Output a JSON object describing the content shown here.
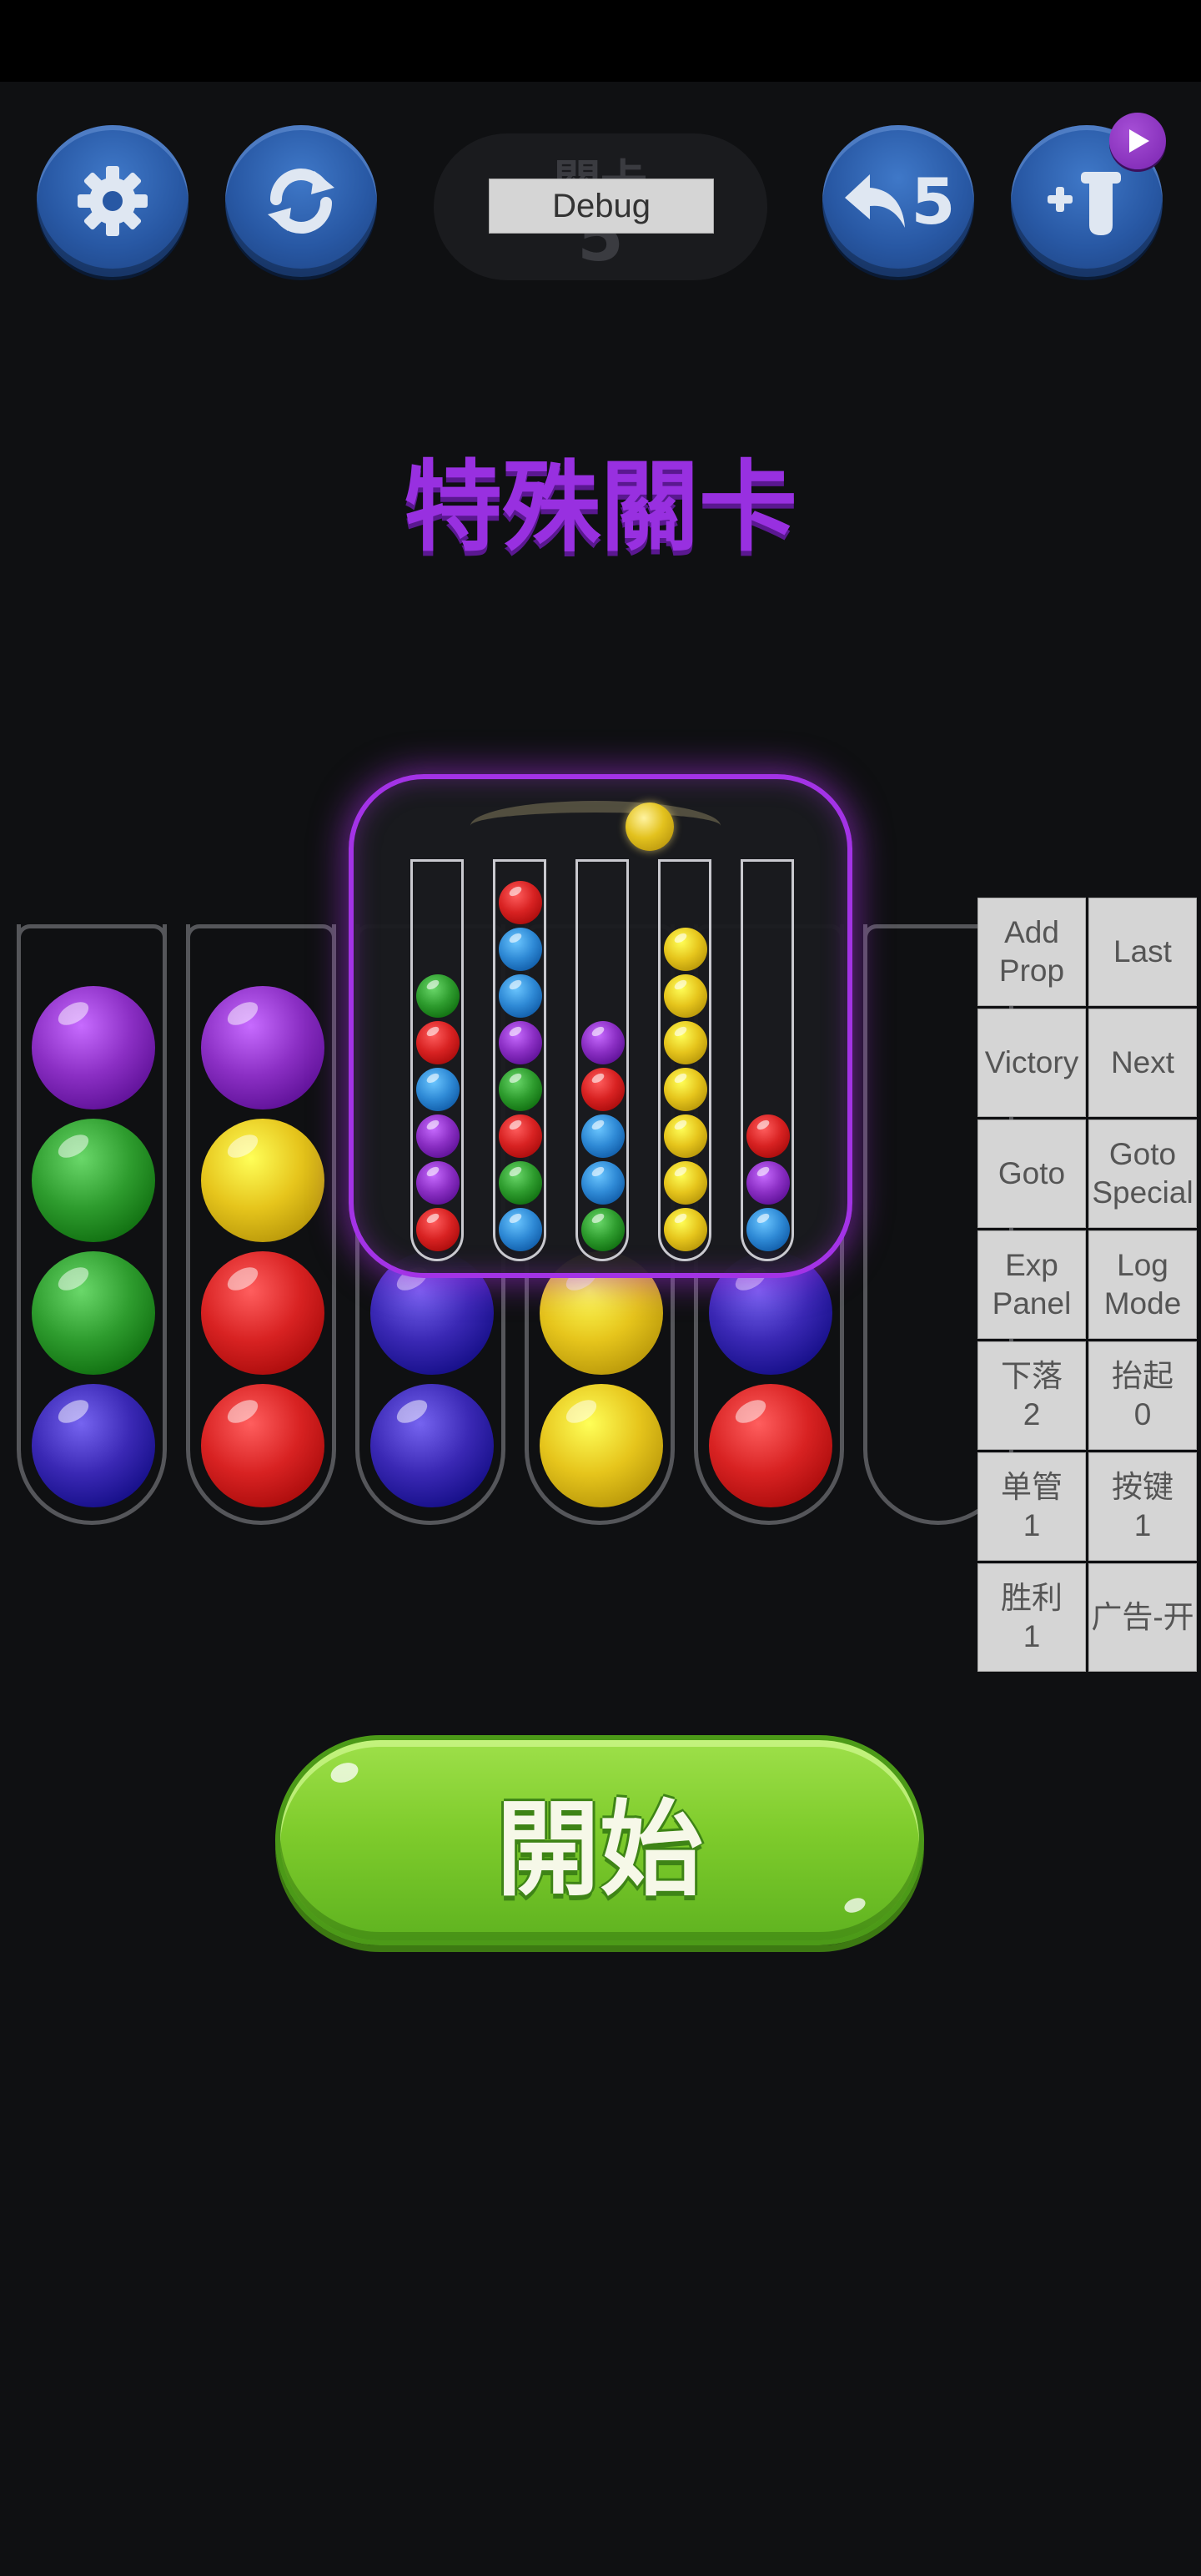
{
  "colors": {
    "purple": "#8b2fc4",
    "green": "#2e9c2e",
    "indigo": "#3a28b4",
    "yellow": "#e6c51c",
    "red": "#d82222",
    "blue": "#2f8ad6",
    "accent_purple": "#9830e0",
    "start_green": "#7fcc2c"
  },
  "toolbar": {
    "settings_icon": "gear-icon",
    "restart_icon": "restart-icon",
    "undo_icon": "undo-icon",
    "undo_count": "5",
    "add_tube_icon": "add-tube-icon",
    "ad_badge_icon": "play-icon"
  },
  "level": {
    "label": "關卡",
    "number": "5"
  },
  "debug_button": "Debug",
  "special_title": "特殊關卡",
  "background_tubes": [
    {
      "balls": [
        "purple",
        "green",
        "green",
        "indigo"
      ]
    },
    {
      "balls": [
        "purple",
        "yellow",
        "red",
        "red"
      ]
    },
    {
      "balls": [
        "",
        "",
        "indigo",
        "indigo"
      ]
    },
    {
      "balls": [
        "",
        "",
        "yellow",
        "yellow"
      ]
    },
    {
      "balls": [
        "",
        "",
        "indigo",
        "red"
      ]
    },
    {
      "balls": []
    }
  ],
  "preview_tubes": [
    {
      "balls": [
        "green",
        "red",
        "blue",
        "purple",
        "purple",
        "red"
      ]
    },
    {
      "balls": [
        "red",
        "blue",
        "blue",
        "purple",
        "green",
        "red",
        "green",
        "blue"
      ]
    },
    {
      "balls": [
        "purple",
        "red",
        "blue",
        "blue",
        "green"
      ]
    },
    {
      "balls": [
        "yellow",
        "yellow",
        "yellow",
        "yellow",
        "yellow",
        "yellow",
        "yellow"
      ]
    },
    {
      "balls": [
        "red",
        "purple",
        "blue"
      ]
    }
  ],
  "debug_panel": [
    [
      "Add\nProp",
      "Last"
    ],
    [
      "Victory",
      "Next"
    ],
    [
      "Goto",
      "Goto\nSpecial"
    ],
    [
      "Exp\nPanel",
      "Log\nMode"
    ],
    [
      "下落\n2",
      "抬起\n0"
    ],
    [
      "单管\n1",
      "按键\n1"
    ],
    [
      "胜利\n1",
      "广告-开"
    ]
  ],
  "start_button": "開始"
}
